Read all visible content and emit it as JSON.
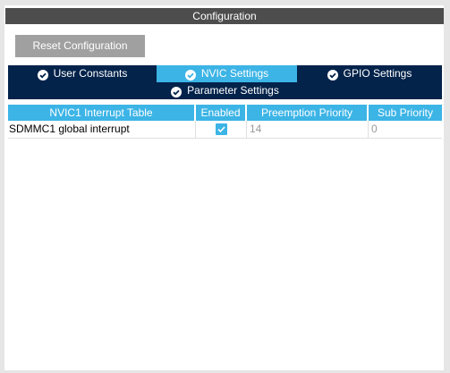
{
  "panel": {
    "title": "Configuration"
  },
  "toolbar": {
    "reset_label": "Reset Configuration"
  },
  "tabs": [
    {
      "label": "User Constants"
    },
    {
      "label": "NVIC Settings"
    },
    {
      "label": "GPIO Settings"
    },
    {
      "label": "Parameter Settings"
    }
  ],
  "active_tab": "NVIC Settings",
  "table": {
    "headers": [
      "NVIC1 Interrupt Table",
      "Enabled",
      "Preemption Priority",
      "Sub Priority"
    ],
    "rows": [
      {
        "name": "SDMMC1 global interrupt",
        "enabled": true,
        "preemption": "14",
        "sub": "0"
      }
    ]
  },
  "colors": {
    "tab_bg": "#03234b",
    "tab_active": "#3cb4e6",
    "title_bg": "#4d4d4d",
    "button_bg": "#a0a0a0"
  },
  "icons": {
    "tab": "check-circle-icon",
    "checkbox": "checkmark-icon"
  }
}
